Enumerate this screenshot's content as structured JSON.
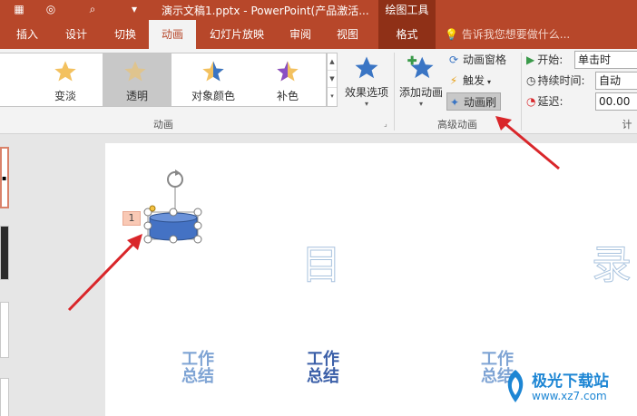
{
  "titlebar": {
    "title": "演示文稿1.pptx - PowerPoint(产品激活...",
    "context_label": "绘图工具"
  },
  "tabs": [
    {
      "label": "插入"
    },
    {
      "label": "设计"
    },
    {
      "label": "切换"
    },
    {
      "label": "动画",
      "active": true
    },
    {
      "label": "幻灯片放映"
    },
    {
      "label": "审阅"
    },
    {
      "label": "视图"
    },
    {
      "label": "格式",
      "context": true
    }
  ],
  "tell_me": "告诉我您想要做什么...",
  "gallery": {
    "items": [
      {
        "label": "变淡",
        "icon": "star-fade-icon"
      },
      {
        "label": "透明",
        "icon": "star-transparent-icon",
        "selected": true
      },
      {
        "label": "对象颜色",
        "icon": "star-object-color-icon"
      },
      {
        "label": "补色",
        "icon": "star-complementary-icon"
      }
    ]
  },
  "effect_options": "效果选项",
  "group_animation": "动画",
  "add_animation": "添加动画",
  "animation_pane": "动画窗格",
  "trigger": "触发",
  "animation_painter": "动画刷",
  "group_advanced": "高级动画",
  "timing": {
    "start_label": "开始:",
    "start_value": "单击时",
    "duration_label": "持续时间:",
    "duration_value": "自动",
    "delay_label": "延迟:",
    "delay_value": "00.00",
    "group_label": "计"
  },
  "slide": {
    "badge": "1",
    "char_mu": "目",
    "char_lu": "录",
    "labels": [
      "工作\n总结",
      "工作\n总结",
      "工作\n总结"
    ]
  },
  "watermark": {
    "title": "极光下载站",
    "url": "www.xz7.com"
  },
  "colors": {
    "accent": "#b7472a",
    "arrow": "#d9262a",
    "shape_fill": "#4472c4"
  }
}
